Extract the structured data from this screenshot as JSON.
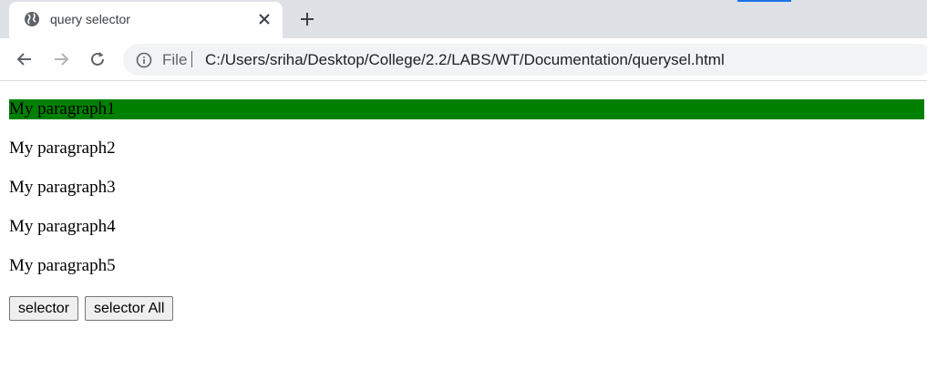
{
  "tab": {
    "title": "query selector",
    "favicon": "globe-icon"
  },
  "toolbar": {
    "back_icon": "back-arrow-icon",
    "forward_icon": "forward-arrow-icon",
    "reload_icon": "reload-icon",
    "scheme_label": "File",
    "url": "C:/Users/sriha/Desktop/College/2.2/LABS/WT/Documentation/querysel.html"
  },
  "page": {
    "paragraphs": [
      "My paragraph1",
      "My paragraph2",
      "My paragraph3",
      "My paragraph4",
      "My paragraph5"
    ],
    "highlight_color": "#008000",
    "buttons": {
      "selector": "selector",
      "selector_all": "selector All"
    }
  },
  "colors": {
    "tabstrip": "#dee1e6",
    "omnibox": "#f1f3f4",
    "accent": "#1a73e8"
  }
}
